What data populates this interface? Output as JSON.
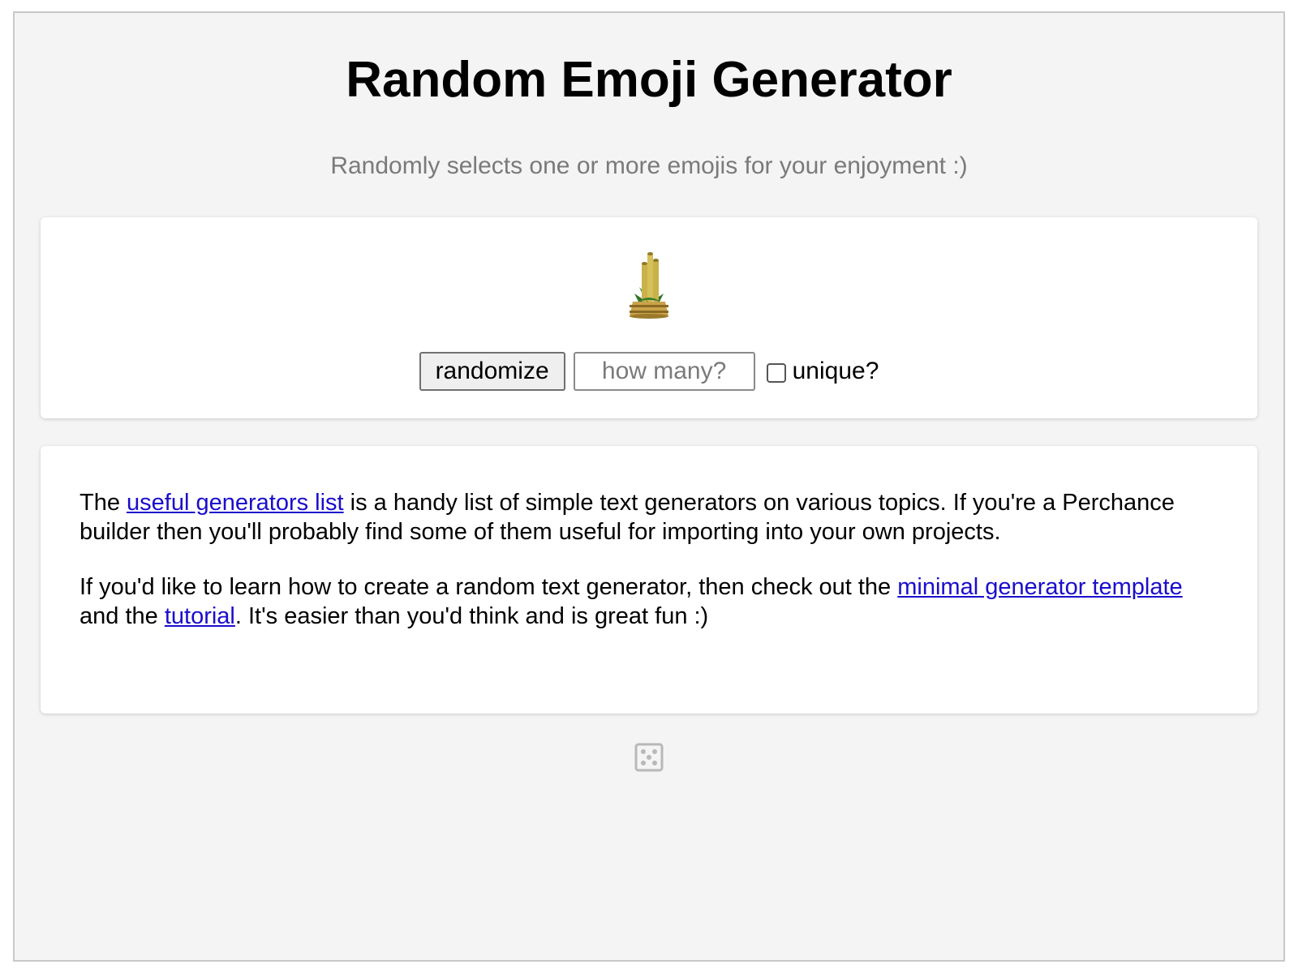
{
  "page": {
    "title": "Random Emoji Generator",
    "subtitle": "Randomly selects one or more emojis for your enjoyment :)"
  },
  "output": {
    "emoji_icon": "kadomatsu-icon"
  },
  "controls": {
    "randomize_label": "randomize",
    "count_placeholder": "how many?",
    "count_value": "",
    "unique_label": "unique?",
    "unique_checked": false
  },
  "info": {
    "p1_before": "The ",
    "p1_link": "useful generators list",
    "p1_after": " is a handy list of simple text generators on various topics. If you're a Perchance builder then you'll probably find some of them useful for importing into your own projects.",
    "p2_before": "If you'd like to learn how to create a random text generator, then check out the ",
    "p2_link1": "minimal generator template",
    "p2_mid": " and the ",
    "p2_link2": "tutorial",
    "p2_after": ". It's easier than you'd think and is great fun :)"
  },
  "footer": {
    "icon": "dice-icon"
  },
  "colors": {
    "background": "#f4f4f4",
    "card": "#ffffff",
    "link": "#1a0dcc",
    "subtitle": "#7a7a7a"
  }
}
